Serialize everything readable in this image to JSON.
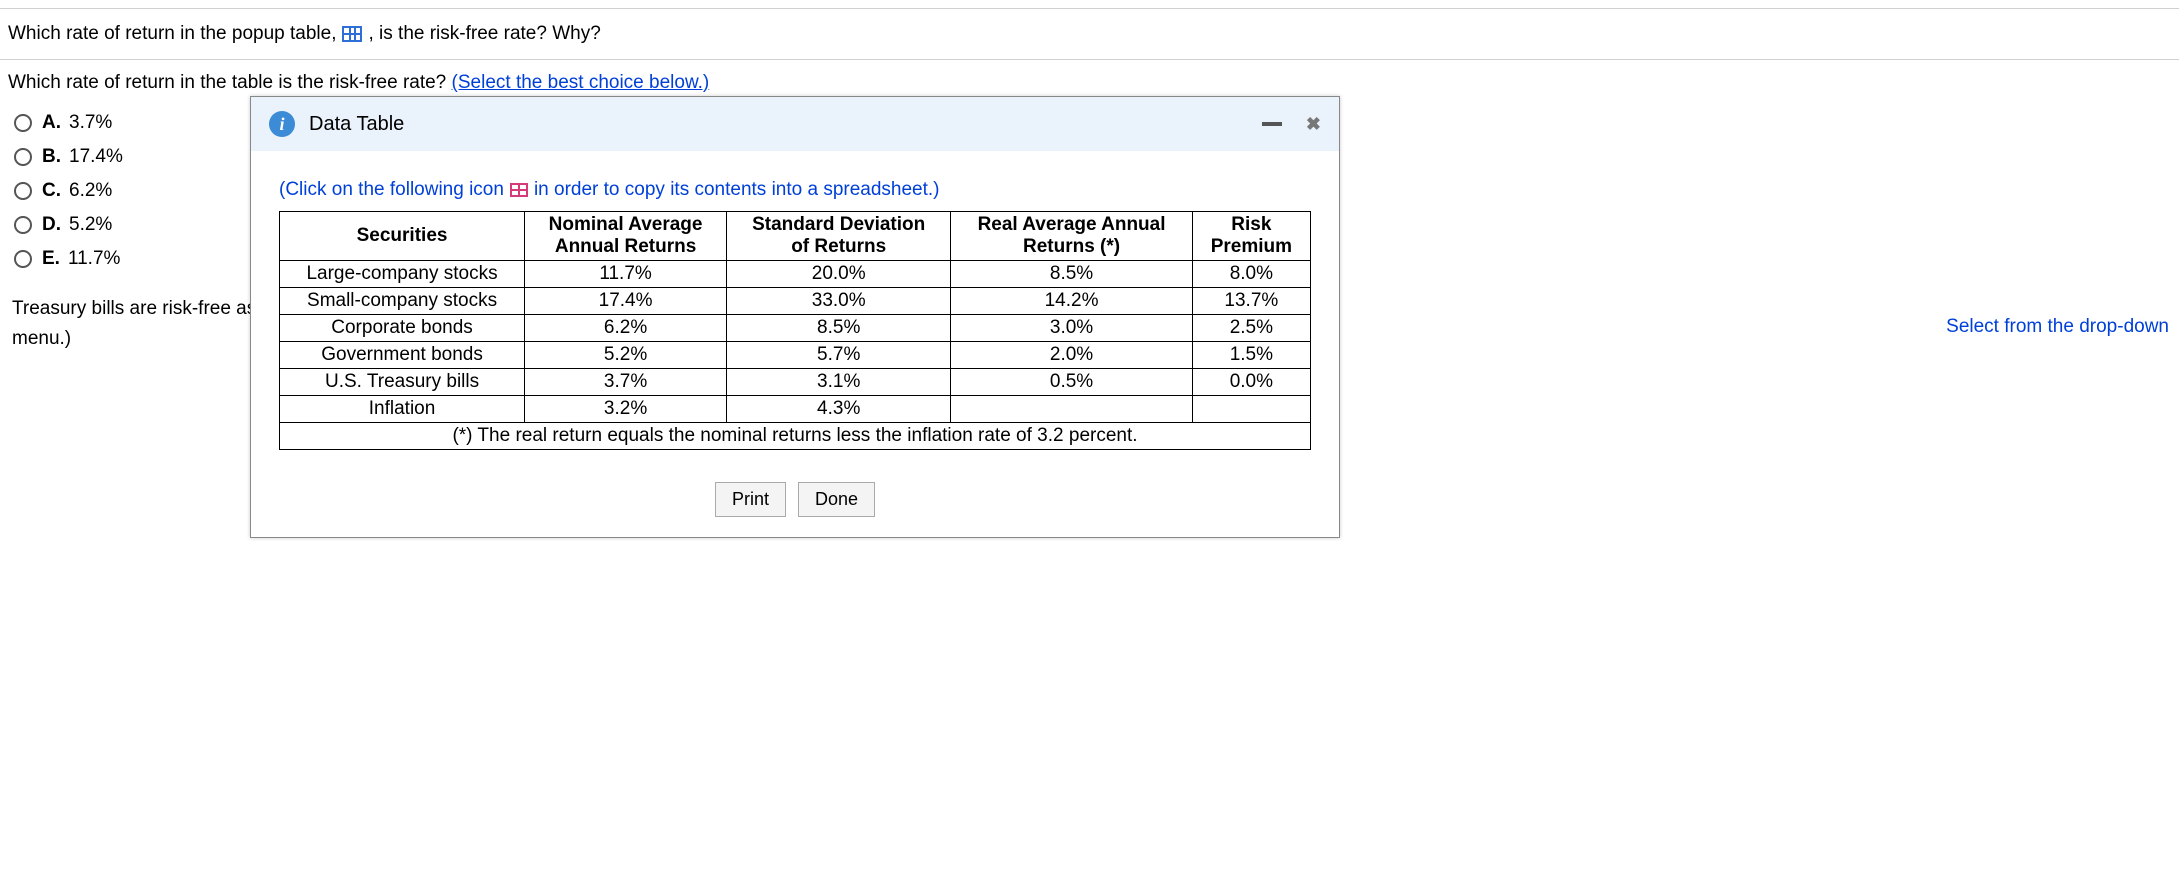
{
  "question": {
    "main_pre": "Which rate of return in the popup table, ",
    "main_post": " , is the risk-free rate? Why?",
    "sub_pre": "Which rate of return in the table is the risk-free rate?  ",
    "sub_link": "(Select the best choice below.)"
  },
  "options": [
    {
      "letter": "A.",
      "value": "3.7%"
    },
    {
      "letter": "B.",
      "value": "17.4%"
    },
    {
      "letter": "C.",
      "value": "6.2%"
    },
    {
      "letter": "D.",
      "value": "5.2%"
    },
    {
      "letter": "E.",
      "value": "11.7%"
    }
  ],
  "explanation_visible": "Treasury bills are risk-free ass",
  "explanation_line2": "menu.)",
  "right_hint": "Select from the drop-down",
  "modal": {
    "title": "Data Table",
    "copy_hint_pre": "(Click on the following icon ",
    "copy_hint_post": " in order to copy its contents into a spreadsheet.)",
    "headers": [
      "Securities",
      "Nominal Average Annual Returns",
      "Standard Deviation of Returns",
      "Real Average Annual Returns (*)",
      "Risk Premium"
    ],
    "rows": [
      [
        "Large-company stocks",
        "11.7%",
        "20.0%",
        "8.5%",
        "8.0%"
      ],
      [
        "Small-company stocks",
        "17.4%",
        "33.0%",
        "14.2%",
        "13.7%"
      ],
      [
        "Corporate bonds",
        "6.2%",
        "8.5%",
        "3.0%",
        "2.5%"
      ],
      [
        "Government bonds",
        "5.2%",
        "5.7%",
        "2.0%",
        "1.5%"
      ],
      [
        "U.S. Treasury bills",
        "3.7%",
        "3.1%",
        "0.5%",
        "0.0%"
      ],
      [
        "Inflation",
        "3.2%",
        "4.3%",
        "",
        ""
      ]
    ],
    "footnote": "(*) The real return equals the nominal returns less the inflation rate of 3.2 percent.",
    "buttons": {
      "print": "Print",
      "done": "Done"
    }
  },
  "chart_data": {
    "type": "table",
    "title": "Data Table",
    "columns": [
      "Securities",
      "Nominal Average Annual Returns",
      "Standard Deviation of Returns",
      "Real Average Annual Returns (*)",
      "Risk Premium"
    ],
    "rows": [
      {
        "Securities": "Large-company stocks",
        "Nominal Average Annual Returns": 11.7,
        "Standard Deviation of Returns": 20.0,
        "Real Average Annual Returns (*)": 8.5,
        "Risk Premium": 8.0
      },
      {
        "Securities": "Small-company stocks",
        "Nominal Average Annual Returns": 17.4,
        "Standard Deviation of Returns": 33.0,
        "Real Average Annual Returns (*)": 14.2,
        "Risk Premium": 13.7
      },
      {
        "Securities": "Corporate bonds",
        "Nominal Average Annual Returns": 6.2,
        "Standard Deviation of Returns": 8.5,
        "Real Average Annual Returns (*)": 3.0,
        "Risk Premium": 2.5
      },
      {
        "Securities": "Government bonds",
        "Nominal Average Annual Returns": 5.2,
        "Standard Deviation of Returns": 5.7,
        "Real Average Annual Returns (*)": 2.0,
        "Risk Premium": 1.5
      },
      {
        "Securities": "U.S. Treasury bills",
        "Nominal Average Annual Returns": 3.7,
        "Standard Deviation of Returns": 3.1,
        "Real Average Annual Returns (*)": 0.5,
        "Risk Premium": 0.0
      },
      {
        "Securities": "Inflation",
        "Nominal Average Annual Returns": 3.2,
        "Standard Deviation of Returns": 4.3,
        "Real Average Annual Returns (*)": null,
        "Risk Premium": null
      }
    ],
    "footnote": "(*) The real return equals the nominal returns less the inflation rate of 3.2 percent."
  }
}
